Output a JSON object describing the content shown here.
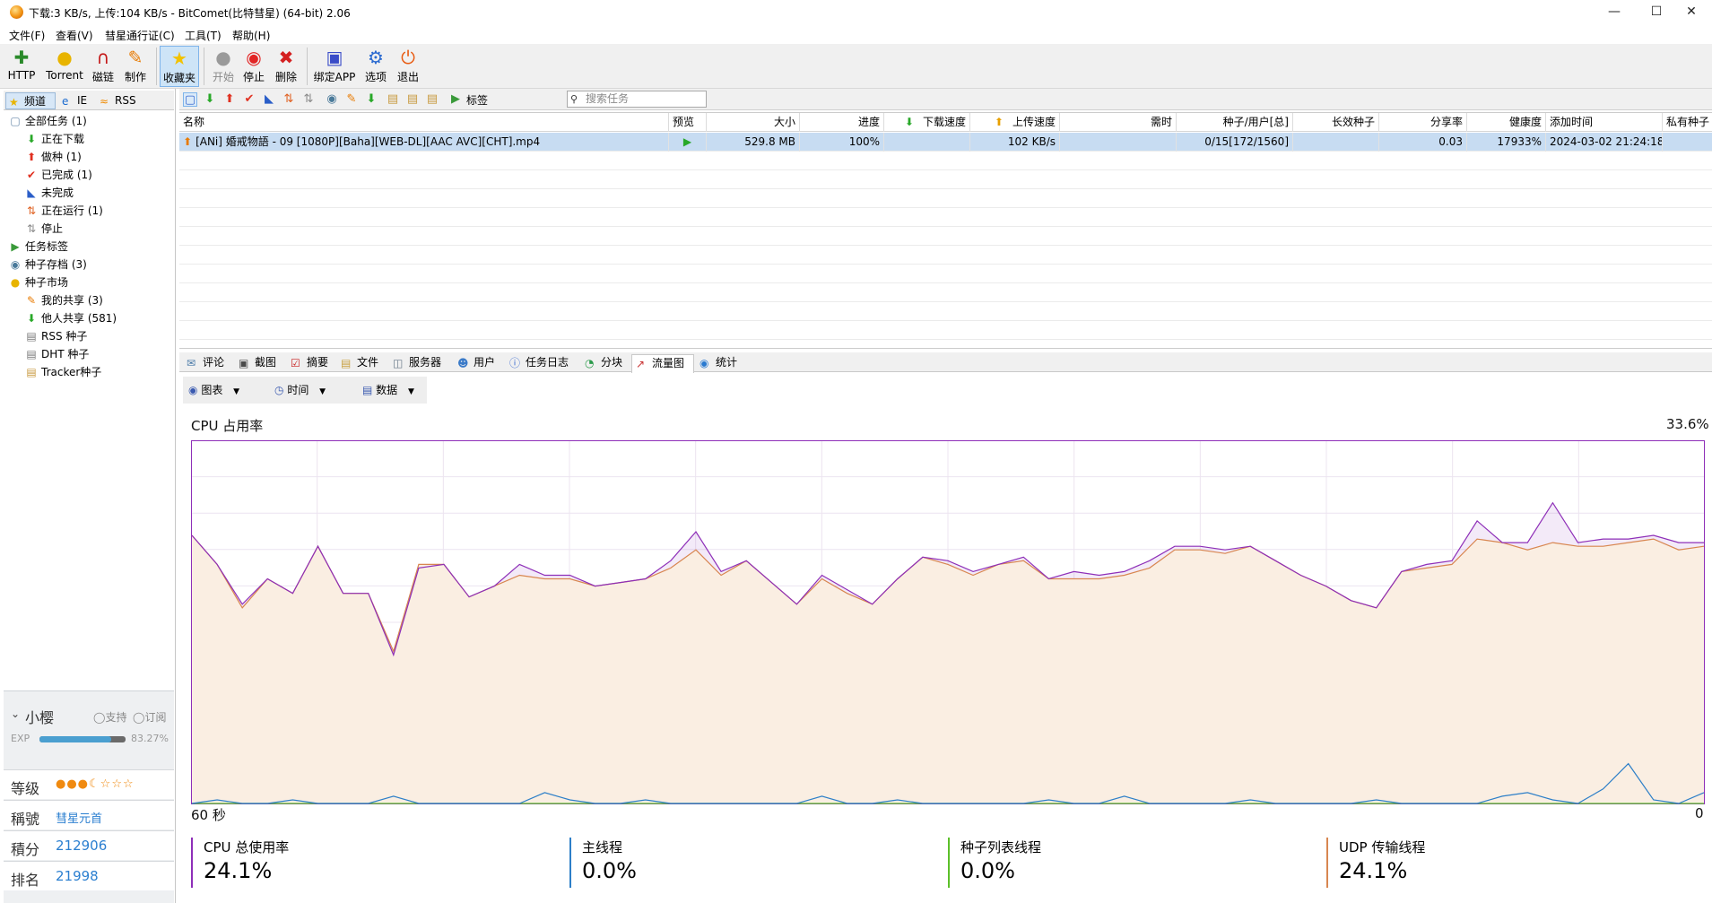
{
  "window": {
    "title": "下载:3 KB/s, 上传:104 KB/s - BitComet(比特彗星) (64-bit) 2.06"
  },
  "menu": [
    "文件(F)",
    "查看(V)",
    "彗星通行证(C)",
    "工具(T)",
    "帮助(H)"
  ],
  "toolbar": {
    "http": "HTTP",
    "torrent": "Torrent",
    "magnet": "磁链",
    "make": "制作",
    "favorites": "收藏夹",
    "start": "开始",
    "stop": "停止",
    "delete": "删除",
    "bind_app": "绑定APP",
    "options": "选项",
    "exit": "退出"
  },
  "left_tabs": {
    "channel": "频道",
    "ie": "IE",
    "rss": "RSS"
  },
  "tree": {
    "all_tasks": "全部任务 (1)",
    "downloading": "正在下载",
    "seeding": "做种 (1)",
    "completed": "已完成 (1)",
    "incomplete": "未完成",
    "running": "正在运行 (1)",
    "stopped": "停止",
    "task_tags": "任务标签",
    "torrent_archive": "种子存档 (3)",
    "torrent_market": "种子市场",
    "my_share": "我的共享 (3)",
    "others_share": "他人共享 (581)",
    "rss_seed": "RSS 种子",
    "dht_seed": "DHT 种子",
    "tracker_seed": "Tracker种子"
  },
  "user": {
    "name": "小樱",
    "support": "支持",
    "subscribe": "订阅",
    "exp_label": "EXP",
    "exp_percent": "83.27%",
    "exp_fraction": 0.8327,
    "level_label": "等级",
    "title_label": "稱號",
    "title_value": "彗星元首",
    "points_label": "積分",
    "points_value": "212906",
    "rank_label": "排名",
    "rank_value": "21998"
  },
  "task_toolbar": {
    "tag": "标签",
    "search_placeholder": "搜索任务"
  },
  "table": {
    "headers": [
      "名称",
      "预览",
      "大小",
      "进度",
      "下载速度",
      "上传速度",
      "需时",
      "种子/用户[总]",
      "长效种子",
      "分享率",
      "健康度",
      "添加时间",
      "私有种子"
    ],
    "rows": [
      {
        "name": "[ANi] 婚戒物語 - 09 [1080P][Baha][WEB-DL][AAC AVC][CHT].mp4",
        "size": "529.8 MB",
        "progress": "100%",
        "download_speed": "",
        "upload_speed": "102 KB/s",
        "eta": "",
        "seeds_peers": "0/15[172/1560]",
        "long_seeds": "",
        "share_ratio": "0.03",
        "health": "17933%",
        "added": "2024-03-02 21:24:18"
      }
    ]
  },
  "detail_tabs": [
    "评论",
    "截图",
    "摘要",
    "文件",
    "服务器",
    "用户",
    "任务日志",
    "分块",
    "流量图",
    "统计"
  ],
  "sub_toolbar": {
    "chart": "图表",
    "time": "时间",
    "data": "数据"
  },
  "chart": {
    "title": "CPU 占用率",
    "current": "33.6%",
    "x_left": "60 秒",
    "x_right": "0"
  },
  "metrics": [
    {
      "name": "CPU 总使用率",
      "value": "24.1%",
      "color": "#8e2fb8"
    },
    {
      "name": "主线程",
      "value": "0.0%",
      "color": "#2d7fc8"
    },
    {
      "name": "种子列表线程",
      "value": "0.0%",
      "color": "#5cc02a"
    },
    {
      "name": "UDP 传输线程",
      "value": "24.1%",
      "color": "#d88650"
    }
  ],
  "chart_data": {
    "type": "line",
    "title": "CPU 占用率",
    "xlabel": "",
    "ylabel": "",
    "xlim": [
      60,
      0
    ],
    "ylim": [
      0,
      100
    ],
    "grid": true,
    "x": [
      60,
      59,
      58,
      57,
      56,
      55,
      54,
      53,
      52,
      51,
      50,
      49,
      48,
      47,
      46,
      45,
      44,
      43,
      42,
      41,
      40,
      39,
      38,
      37,
      36,
      35,
      34,
      33,
      32,
      31,
      30,
      29,
      28,
      27,
      26,
      25,
      24,
      23,
      22,
      21,
      20,
      19,
      18,
      17,
      16,
      15,
      14,
      13,
      12,
      11,
      10,
      9,
      8,
      7,
      6,
      5,
      4,
      3,
      2,
      1,
      0
    ],
    "series": [
      {
        "name": "CPU 总使用率",
        "color": "#8e2fb8",
        "values": [
          74,
          66,
          55,
          62,
          58,
          71,
          58,
          58,
          41,
          65,
          66,
          57,
          60,
          66,
          63,
          63,
          60,
          61,
          62,
          67,
          75,
          64,
          67,
          61,
          55,
          63,
          59,
          55,
          62,
          68,
          67,
          64,
          66,
          68,
          62,
          64,
          63,
          64,
          67,
          71,
          71,
          70,
          71,
          67,
          63,
          60,
          56,
          54,
          64,
          66,
          67,
          78,
          72,
          72,
          83,
          72,
          73,
          73,
          74,
          72,
          72
        ]
      },
      {
        "name": "UDP 传输线程",
        "color": "#d88650",
        "values": [
          74,
          66,
          54,
          62,
          58,
          71,
          58,
          58,
          42,
          66,
          66,
          57,
          60,
          63,
          62,
          62,
          60,
          61,
          62,
          65,
          70,
          63,
          67,
          61,
          55,
          62,
          58,
          55,
          62,
          68,
          66,
          63,
          66,
          67,
          62,
          62,
          62,
          63,
          65,
          70,
          70,
          69,
          71,
          67,
          63,
          60,
          56,
          54,
          64,
          65,
          66,
          73,
          72,
          70,
          72,
          71,
          71,
          72,
          73,
          70,
          71
        ]
      },
      {
        "name": "主线程",
        "color": "#2d7fc8",
        "values": [
          0,
          1,
          0,
          0,
          1,
          0,
          0,
          0,
          2,
          0,
          0,
          0,
          0,
          0,
          3,
          1,
          0,
          0,
          1,
          0,
          0,
          0,
          0,
          0,
          0,
          2,
          0,
          0,
          1,
          0,
          0,
          0,
          0,
          0,
          1,
          0,
          0,
          2,
          0,
          0,
          0,
          0,
          1,
          0,
          0,
          0,
          0,
          1,
          0,
          0,
          0,
          0,
          2,
          3,
          1,
          0,
          4,
          11,
          1,
          0,
          3
        ]
      },
      {
        "name": "种子列表线程",
        "color": "#5cc02a",
        "values": [
          0,
          0,
          0,
          0,
          0,
          0,
          0,
          0,
          0,
          0,
          0,
          0,
          0,
          0,
          0,
          0,
          0,
          0,
          0,
          0,
          0,
          0,
          0,
          0,
          0,
          0,
          0,
          0,
          0,
          0,
          0,
          0,
          0,
          0,
          0,
          0,
          0,
          0,
          0,
          0,
          0,
          0,
          0,
          0,
          0,
          0,
          0,
          0,
          0,
          0,
          0,
          0,
          0,
          0,
          0,
          0,
          0,
          0,
          0,
          0,
          0
        ]
      }
    ]
  }
}
